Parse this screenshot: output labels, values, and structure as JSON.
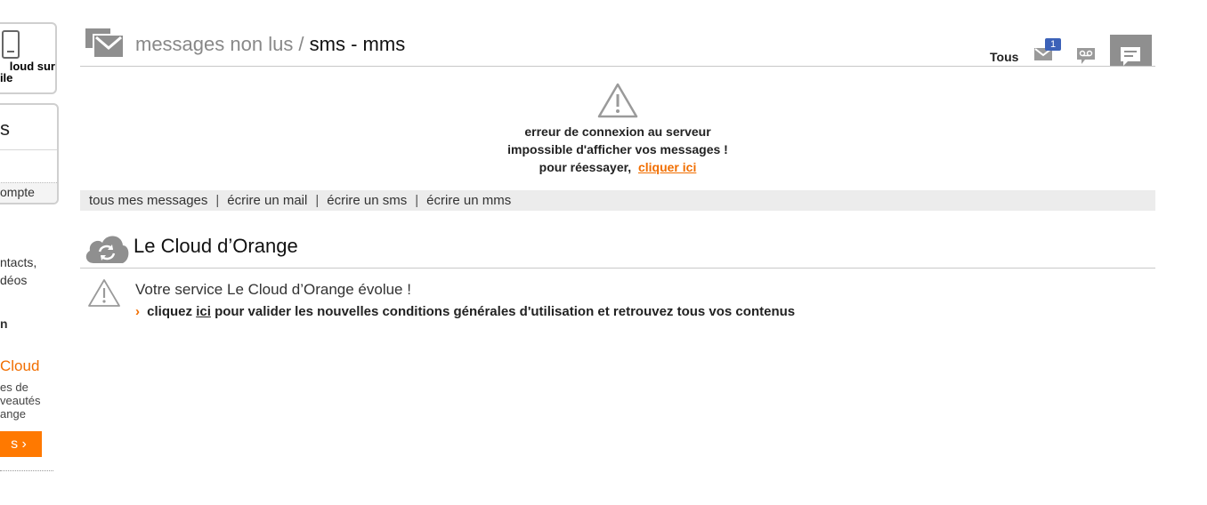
{
  "sidebar": {
    "card1": {
      "line1": "loud sur",
      "line2": "bile"
    },
    "card2": {
      "big": "s",
      "footer": "ompte"
    },
    "text1": "ntacts,",
    "text2": "déos",
    "text3": "n",
    "cloud_word": "Cloud",
    "small1": "es de",
    "small2": "veautés",
    "small3": "ange",
    "button_label": "s  ›"
  },
  "messages": {
    "title_prefix": "messages non lus / ",
    "title_highlight": "sms - mms",
    "filter_label": "Tous",
    "unread_badge": "1",
    "error": {
      "line1": "erreur de connexion au serveur",
      "line2": "impossible d'afficher vos messages !",
      "line3_prefix": "pour réessayer,",
      "retry_link": "cliquer ici"
    },
    "actions": [
      "tous mes messages",
      "écrire un mail",
      "écrire un sms",
      "écrire un mms"
    ]
  },
  "cloud": {
    "title": "Le Cloud d’Orange",
    "notice": "Votre service Le Cloud d’Orange évolue !",
    "cgu_prefix": "cliquez",
    "cgu_link": "ici",
    "cgu_suffix": "pour valider les nouvelles conditions générales d'utilisation et retrouvez tous vos contenus"
  },
  "colors": {
    "accent": "#f16e00",
    "badge": "#3c62b8",
    "icon_grey": "#8f8f8f"
  },
  "icons": [
    "phone-icon",
    "envelope-icon",
    "voicemail-icon",
    "sms-icon",
    "warning-icon",
    "cloud-sync-icon"
  ]
}
